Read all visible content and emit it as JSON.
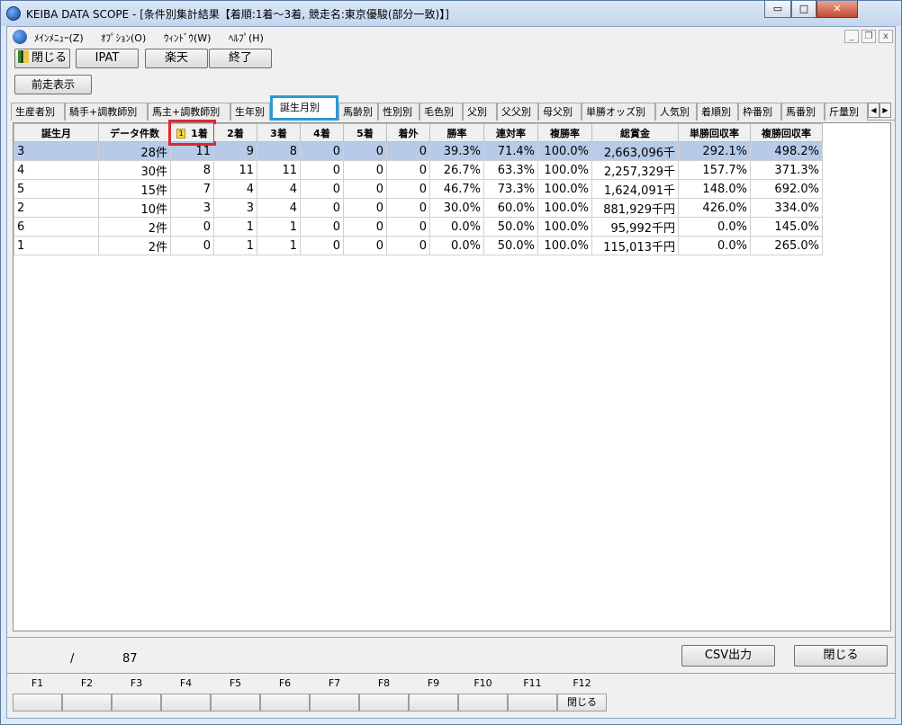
{
  "window": {
    "title": "KEIBA DATA SCOPE - [条件別集計結果【着順:1着～3着, 競走名:東京優駿(部分一致)】]",
    "controls": {
      "minimize": "▭",
      "maximize": "□",
      "close": "✕"
    }
  },
  "menu": {
    "items": [
      "ﾒｲﾝﾒﾆｭｰ(Z)",
      "ｵﾌﾟｼｮﾝ(O)",
      "ｳｨﾝﾄﾞｳ(W)",
      "ﾍﾙﾌﾟ(H)"
    ],
    "mdi": {
      "minimize": "_",
      "restore": "❐",
      "close": "x"
    }
  },
  "toolbar": {
    "close_label": "閉じる",
    "ipat_label": "IPAT",
    "rakuten_label": "楽天",
    "exit_label": "終了",
    "prev_race_label": "前走表示"
  },
  "tabs": {
    "items": [
      "生産者別",
      "騎手+調教師別",
      "馬主+調教師別",
      "生年別",
      "誕生月別",
      "馬齢別",
      "性別別",
      "毛色別",
      "父別",
      "父父別",
      "母父別",
      "単勝オッズ別",
      "人気別",
      "着順別",
      "枠番別",
      "馬番別",
      "斤量別"
    ],
    "active": "誕生月別",
    "scroll_left": "◀",
    "scroll_right": "▶"
  },
  "grid": {
    "sort_badge": "1",
    "columns": [
      "誕生月",
      "データ件数",
      "1着",
      "2着",
      "3着",
      "4着",
      "5着",
      "着外",
      "勝率",
      "連対率",
      "複勝率",
      "総賞金",
      "単勝回収率",
      "複勝回収率"
    ],
    "rows": [
      [
        "3",
        "28件",
        "11",
        "9",
        "8",
        "0",
        "0",
        "0",
        "39.3%",
        "71.4%",
        "100.0%",
        "2,663,096千",
        "292.1%",
        "498.2%"
      ],
      [
        "4",
        "30件",
        "8",
        "11",
        "11",
        "0",
        "0",
        "0",
        "26.7%",
        "63.3%",
        "100.0%",
        "2,257,329千",
        "157.7%",
        "371.3%"
      ],
      [
        "5",
        "15件",
        "7",
        "4",
        "4",
        "0",
        "0",
        "0",
        "46.7%",
        "73.3%",
        "100.0%",
        "1,624,091千",
        "148.0%",
        "692.0%"
      ],
      [
        "2",
        "10件",
        "3",
        "3",
        "4",
        "0",
        "0",
        "0",
        "30.0%",
        "60.0%",
        "100.0%",
        "881,929千円",
        "426.0%",
        "334.0%"
      ],
      [
        "6",
        "2件",
        "0",
        "1",
        "1",
        "0",
        "0",
        "0",
        "0.0%",
        "50.0%",
        "100.0%",
        "95,992千円",
        "0.0%",
        "145.0%"
      ],
      [
        "1",
        "2件",
        "0",
        "1",
        "1",
        "0",
        "0",
        "0",
        "0.0%",
        "50.0%",
        "100.0%",
        "115,013千円",
        "0.0%",
        "265.0%"
      ]
    ],
    "selected_row": 0
  },
  "status": {
    "separator": "/",
    "total": "87",
    "csv_label": "CSV出力",
    "close_label": "閉じる"
  },
  "fkeys": {
    "labels": [
      "F1",
      "F2",
      "F3",
      "F4",
      "F5",
      "F6",
      "F7",
      "F8",
      "F9",
      "F10",
      "F11",
      "F12"
    ],
    "buttons": [
      "",
      "",
      "",
      "",
      "",
      "",
      "",
      "",
      "",
      "",
      "",
      "閉じる"
    ]
  },
  "colors": {
    "selected_row": "#b7cbe8",
    "active_tab_highlight": "#2a9ad6",
    "sort_column_highlight": "#e0262f"
  }
}
